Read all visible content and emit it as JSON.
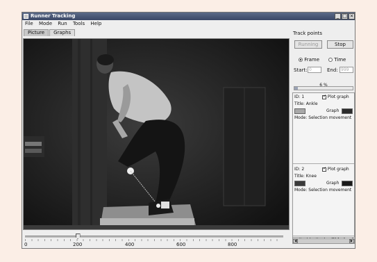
{
  "window": {
    "title": "Runner Tracking",
    "controls": {
      "minimize": "_",
      "maximize": "□",
      "close": "×"
    }
  },
  "menu": [
    "File",
    "Mode",
    "Run",
    "Tools",
    "Help"
  ],
  "tabs": [
    {
      "label": "Picture",
      "active": true
    },
    {
      "label": "Graphs",
      "active": false
    }
  ],
  "video": {
    "icon": "video-frame-image"
  },
  "timeline": {
    "tick_labels": [
      "0",
      "200",
      "400",
      "600",
      "800"
    ],
    "max_value": 1000,
    "current_value": 203
  },
  "navigation": {
    "prev_label": "«",
    "next_label": "»",
    "frame_number": "203",
    "info_icon": "speech-bubble-icon"
  },
  "track_panel": {
    "title": "Track points",
    "running_label": "Running",
    "stop_label": "Stop",
    "frame_option": "Frame",
    "time_option": "Time",
    "selected_option": "Frame",
    "start_label": "Start:",
    "start_value": "0",
    "end_label": "End:",
    "end_value": "999",
    "progress_percent": 6,
    "progress_text": "6 %"
  },
  "points": [
    {
      "id_label": "ID: 1",
      "plot_label": "Plot graph",
      "plot_checked": true,
      "title": "Title: Ankle",
      "graph_label": "Graph",
      "swatch_color": "#a8a8a8",
      "graph_color": "#2b2b2b",
      "mode": "Mode: Selection movement"
    },
    {
      "id_label": "ID: 2",
      "plot_label": "Plot graph",
      "plot_checked": true,
      "title": "Title: Knee",
      "graph_label": "Graph",
      "swatch_color": "#3a3a3a",
      "graph_color": "#1a1a1a",
      "mode": "Mode: Selection movement"
    }
  ],
  "colors": {
    "titlebar": "#3a4766",
    "window_bg": "#eeeeee",
    "page_bg": "#fbeee6"
  }
}
